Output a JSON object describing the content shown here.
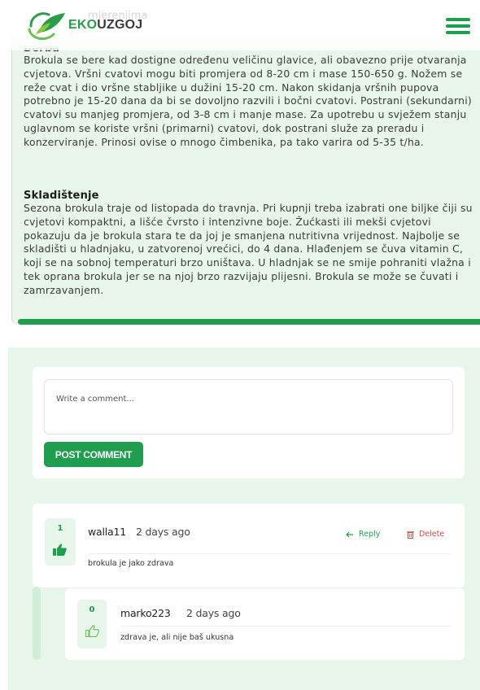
{
  "header": {
    "logo_eko": "EKO",
    "logo_uzgoj": "UZGOJ",
    "ghost_text": "mjerenjima",
    "menu_icon": "hamburger-icon"
  },
  "article": {
    "sections": [
      {
        "heading": "Berba",
        "body": "Brokula se bere kad dostigne određenu veličinu glavice, ali obavezno prije otvaranja cvjetova. Vršni cvatovi mogu biti promjera od 8-20 cm i mase 150-650 g. Nožem se reže cvat i dio vršne stabljike u dužini 15-20 cm. Nakon skidanja vršnih pupova potrebno je 15-20 dana da bi se dovoljno razvili i bočni cvatovi. Postrani (sekundarni) cvatovi su manjeg promjera, od 3-8 cm i manje mase. Za upotrebu u svježem stanju uglavnom se koriste vršni (primarni) cvatovi, dok postrani služe za preradu i konzerviranje. Prinosi ovise o mnogo čimbenika, pa tako varira od 5-35 t/ha."
      },
      {
        "heading": "Skladištenje",
        "body": "Sezona brokula traje od listopada do travnja. Pri kupnji treba izabrati one biljke čiji su cvjetovi kompaktni, a lišće čvrsto i intenzivne boje. Žućkasti ili mekši cvjetovi pokazuju da je brokula stara te da joj je smanjena nutritivna vrijednost. Najbolje se skladišti u hladnjaku, u zatvorenoj vrećici, do 4 dana. Hlađenjem se čuva vitamin C, koji se na sobnoj temperaturi brzo uništava. U hladnjak se ne smije pohraniti vlažna i tek oprana brokula jer se na njoj brzo razvijaju plijesni. Brokula se može se čuvati i zamrzavanjem."
      }
    ]
  },
  "comment_form": {
    "placeholder": "Write a comment...",
    "post_label": "POST COMMENT"
  },
  "comments": [
    {
      "votes": "1",
      "user": "walla11",
      "time": "2 days ago",
      "text": "brokula je jako zdrava",
      "reply_label": "Reply",
      "delete_label": "Delete",
      "liked": true
    },
    {
      "votes": "0",
      "user": "marko223",
      "time": "2 days ago",
      "text": "zdrava je, ali nije baš ukusna",
      "liked": false
    }
  ],
  "colors": {
    "accent": "#1e9e4e",
    "background": "#e7f5ea",
    "delete": "#e0473b"
  }
}
